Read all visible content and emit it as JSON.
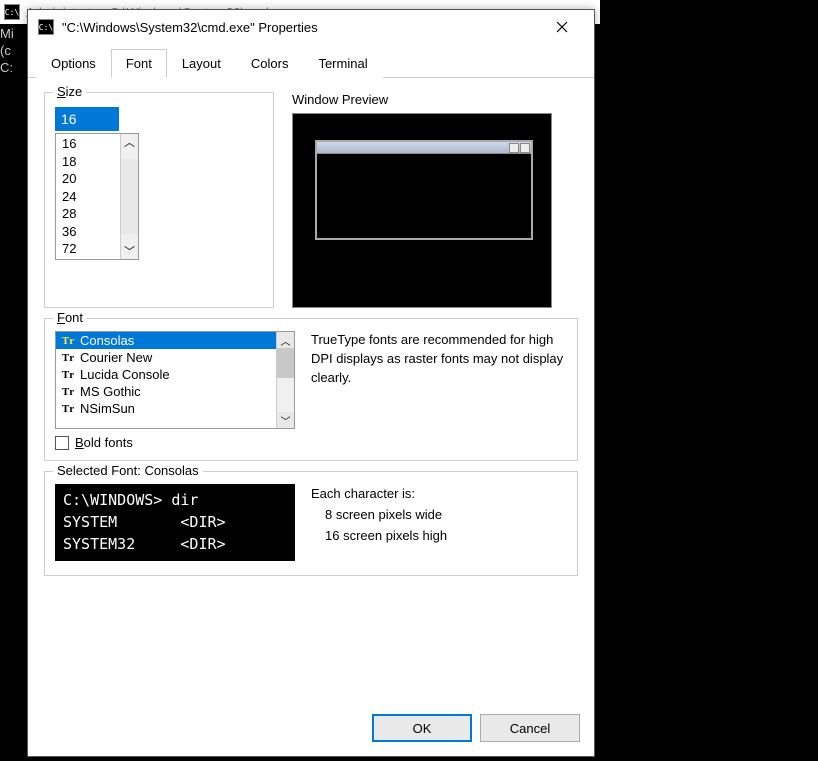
{
  "bg_window_title": "Administrator: C:\\Windows\\System32\\cmd.exe",
  "bg_lines": [
    "Mi",
    "(c",
    "",
    "C:"
  ],
  "dialog": {
    "title": "\"C:\\Windows\\System32\\cmd.exe\" Properties",
    "tabs": [
      "Options",
      "Font",
      "Layout",
      "Colors",
      "Terminal"
    ],
    "active_tab": "Font",
    "size": {
      "label": "Size",
      "value": "16",
      "options": [
        "16",
        "18",
        "20",
        "24",
        "28",
        "36",
        "72"
      ]
    },
    "preview_label": "Window Preview",
    "font": {
      "label": "Font",
      "items": [
        "Consolas",
        "Courier New",
        "Lucida Console",
        "MS Gothic",
        "NSimSun"
      ],
      "selected": "Consolas",
      "description": "TrueType fonts are recommended for high DPI displays as raster fonts may not display clearly.",
      "bold_label": "Bold fonts"
    },
    "selected_font": {
      "label": "Selected Font: Consolas",
      "sample": "C:\\WINDOWS> dir\nSYSTEM       <DIR>\nSYSTEM32     <DIR>",
      "char_heading": "Each character is:",
      "char_wide": "8 screen pixels wide",
      "char_high": "16 screen pixels high"
    },
    "ok": "OK",
    "cancel": "Cancel"
  }
}
